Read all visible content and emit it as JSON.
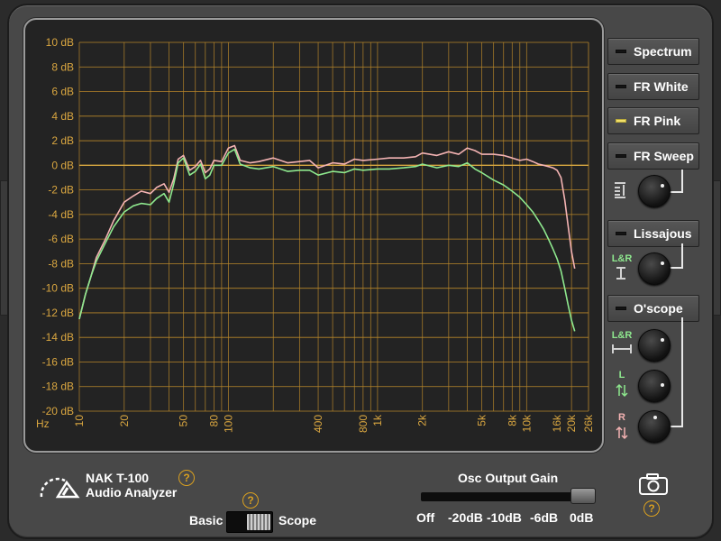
{
  "app": {
    "product_name": "NAK T-100",
    "product_subtitle": "Audio Analyzer"
  },
  "modes": [
    {
      "label": "Spectrum",
      "active": false
    },
    {
      "label": "FR White",
      "active": false
    },
    {
      "label": "FR Pink",
      "active": true
    },
    {
      "label": "FR Sweep",
      "active": false
    },
    {
      "label": "Lissajous",
      "active": false
    },
    {
      "label": "O'scope",
      "active": false
    }
  ],
  "knob_labels": {
    "lissajous_lr": "L&R",
    "oscope_lr": "L&R",
    "oscope_l": "L",
    "oscope_r": "R"
  },
  "mode_switch": {
    "left_label": "Basic",
    "right_label": "Scope",
    "value": "Scope"
  },
  "osc_gain": {
    "title": "Osc Output Gain",
    "ticks": [
      "Off",
      "-20dB",
      "-10dB",
      "-6dB",
      "0dB"
    ],
    "value": "0dB"
  },
  "help_text": "?",
  "colors": {
    "grid": "#b8862a",
    "label": "#d9a640",
    "zero_line": "#d6a640",
    "series_pink": "#f4b3b3",
    "series_green": "#8ee88e",
    "led_on": "#f2e06a"
  },
  "chart_data": {
    "type": "line",
    "xscale": "log",
    "xlim": [
      10,
      26000
    ],
    "ylim": [
      -20,
      10
    ],
    "x_ticks": [
      "10",
      "20",
      "50",
      "80",
      "100",
      "400",
      "800",
      "1k",
      "2k",
      "5k",
      "8k",
      "10k",
      "16k",
      "20k",
      "26k"
    ],
    "x_tick_values": [
      10,
      20,
      50,
      80,
      100,
      400,
      800,
      1000,
      2000,
      5000,
      8000,
      10000,
      16000,
      20000,
      26000
    ],
    "x_unit": "Hz",
    "y_ticks": [
      "10 dB",
      "8 dB",
      "6 dB",
      "4 dB",
      "2 dB",
      "0 dB",
      "-2 dB",
      "-4 dB",
      "-6 dB",
      "-8 dB",
      "-10 dB",
      "-12 dB",
      "-14 dB",
      "-16 dB",
      "-18 dB",
      "-20 dB"
    ],
    "y_tick_values": [
      10,
      8,
      6,
      4,
      2,
      0,
      -2,
      -4,
      -6,
      -8,
      -10,
      -12,
      -14,
      -16,
      -18,
      -20
    ],
    "grid": true,
    "series": [
      {
        "color": "#f4b3b3",
        "x": [
          10,
          11,
          12,
          13,
          15,
          17,
          20,
          23,
          26,
          30,
          33,
          37,
          40,
          43,
          46,
          50,
          55,
          60,
          65,
          70,
          75,
          80,
          90,
          100,
          110,
          120,
          140,
          160,
          200,
          250,
          300,
          350,
          400,
          500,
          600,
          700,
          800,
          1000,
          1200,
          1500,
          1800,
          2000,
          2500,
          3000,
          3500,
          4000,
          4500,
          5000,
          6000,
          7000,
          8000,
          9000,
          10000,
          11000,
          12000,
          13000,
          14000,
          15000,
          16000,
          17000,
          18000,
          19000,
          20000,
          21000
        ],
        "y": [
          -12.5,
          -10.5,
          -9,
          -7.5,
          -6,
          -4.5,
          -3,
          -2.5,
          -2.1,
          -2.3,
          -1.8,
          -1.5,
          -2.2,
          -1.1,
          0.5,
          0.8,
          -0.4,
          -0.1,
          0.4,
          -0.6,
          -0.3,
          0.4,
          0.3,
          1.4,
          1.6,
          0.4,
          0.2,
          0.3,
          0.6,
          0.2,
          0.3,
          0.4,
          -0.2,
          0.2,
          0.1,
          0.5,
          0.4,
          0.5,
          0.6,
          0.6,
          0.7,
          1,
          0.8,
          1.1,
          0.9,
          1.4,
          1.2,
          0.9,
          0.9,
          0.8,
          0.6,
          0.4,
          0.5,
          0.3,
          0.1,
          0.0,
          -0.1,
          -0.2,
          -0.4,
          -1.0,
          -2.8,
          -5.0,
          -7.0,
          -8.4
        ]
      },
      {
        "color": "#8ee88e",
        "x": [
          10,
          11,
          12,
          13,
          15,
          17,
          20,
          23,
          26,
          30,
          33,
          37,
          40,
          43,
          46,
          50,
          55,
          60,
          65,
          70,
          75,
          80,
          90,
          100,
          110,
          120,
          140,
          160,
          200,
          250,
          300,
          350,
          400,
          500,
          600,
          700,
          800,
          1000,
          1200,
          1500,
          1800,
          2000,
          2500,
          3000,
          3500,
          4000,
          4500,
          5000,
          6000,
          7000,
          8000,
          9000,
          10000,
          11000,
          12000,
          13000,
          14000,
          15000,
          16000,
          17000,
          18000,
          19000,
          20000,
          21000
        ],
        "y": [
          -12.5,
          -10.5,
          -9,
          -7.8,
          -6.3,
          -5,
          -3.8,
          -3.3,
          -3.1,
          -3.2,
          -2.7,
          -2.3,
          -3,
          -1.5,
          0.2,
          0.6,
          -0.8,
          -0.5,
          0.1,
          -1.1,
          -0.8,
          0.0,
          0.0,
          1.0,
          1.3,
          0.1,
          -0.2,
          -0.3,
          -0.1,
          -0.5,
          -0.4,
          -0.4,
          -0.8,
          -0.5,
          -0.6,
          -0.3,
          -0.4,
          -0.3,
          -0.3,
          -0.2,
          -0.1,
          0.1,
          -0.2,
          0,
          -0.1,
          0.2,
          -0.3,
          -0.6,
          -1.2,
          -1.6,
          -2.1,
          -2.6,
          -3.2,
          -3.8,
          -4.5,
          -5.2,
          -6.0,
          -6.8,
          -7.6,
          -8.6,
          -10,
          -11.4,
          -12.6,
          -13.5
        ]
      }
    ]
  }
}
